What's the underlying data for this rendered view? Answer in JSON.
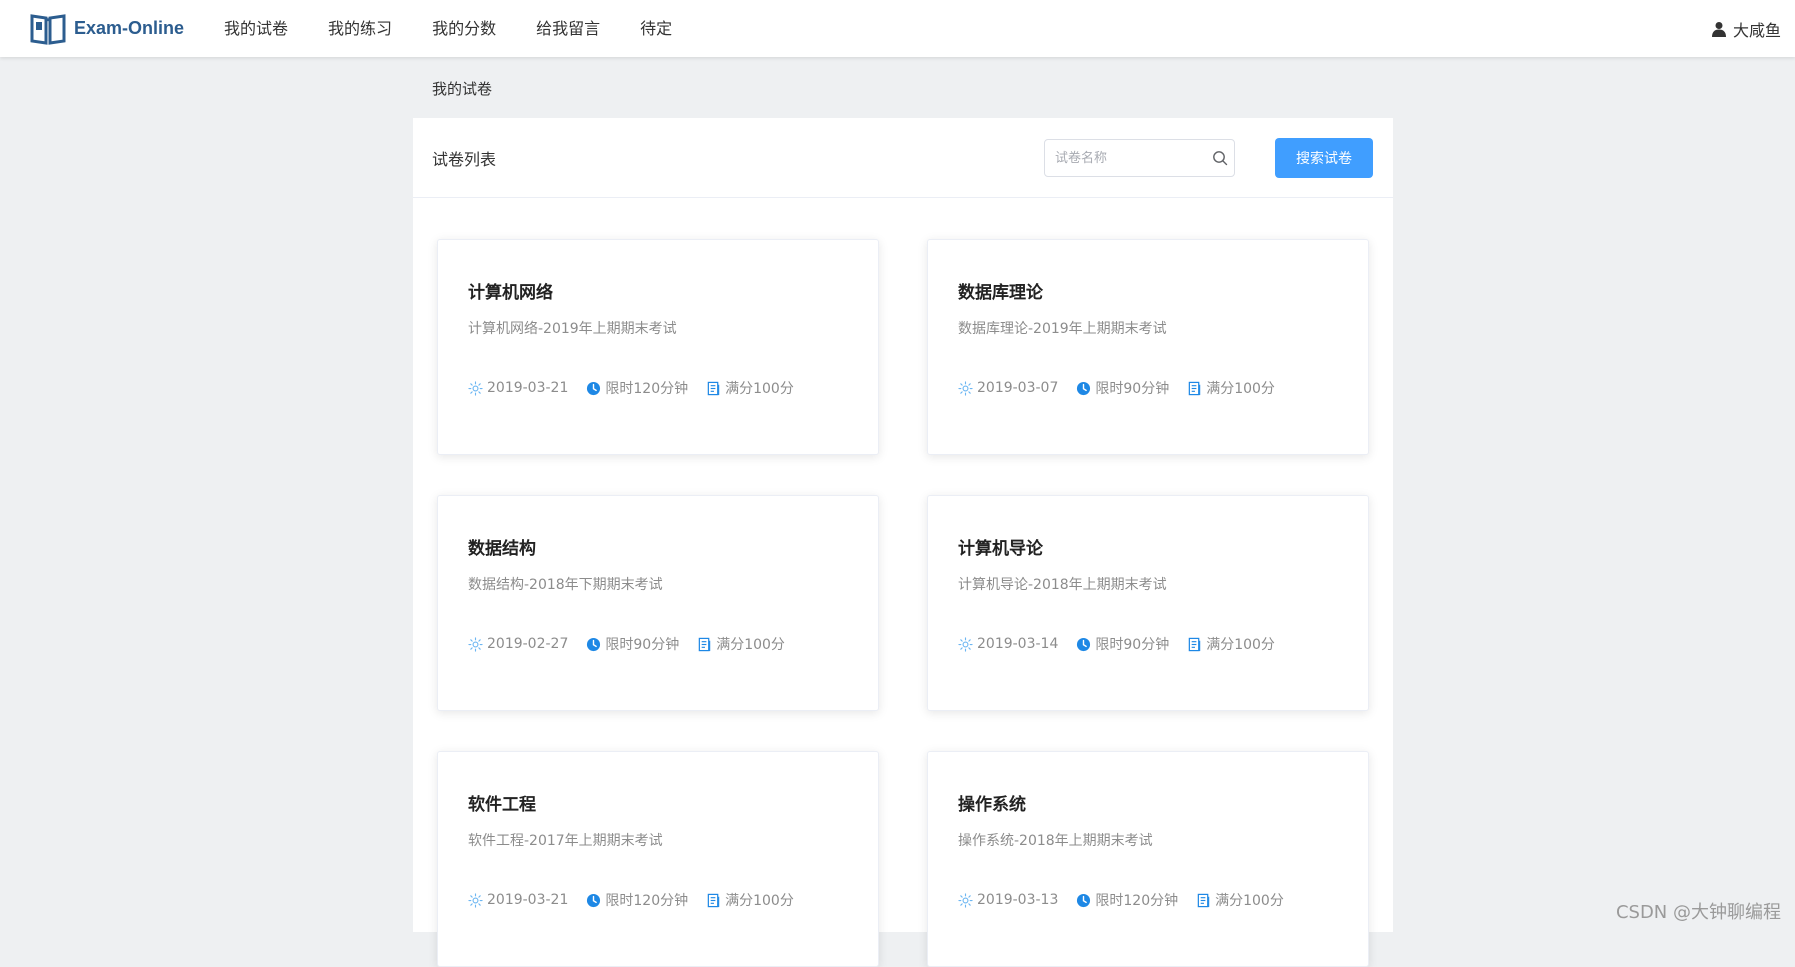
{
  "app": {
    "name": "Exam-Online"
  },
  "nav": {
    "items": [
      {
        "label": "我的试卷"
      },
      {
        "label": "我的练习"
      },
      {
        "label": "我的分数"
      },
      {
        "label": "给我留言"
      },
      {
        "label": "待定"
      }
    ]
  },
  "user": {
    "name": "大咸鱼",
    "icon": "user-icon"
  },
  "breadcrumb": "我的试卷",
  "panel": {
    "title": "试卷列表",
    "search": {
      "placeholder": "试卷名称",
      "value": "",
      "icon": "search-icon"
    },
    "search_button": "搜索试卷"
  },
  "papers": [
    {
      "title": "计算机网络",
      "desc": "计算机网络-2019年上期期末考试",
      "date": "2019-03-21",
      "time": "限时120分钟",
      "score": "满分100分"
    },
    {
      "title": "数据库理论",
      "desc": "数据库理论-2019年上期期末考试",
      "date": "2019-03-07",
      "time": "限时90分钟",
      "score": "满分100分"
    },
    {
      "title": "数据结构",
      "desc": "数据结构-2018年下期期末考试",
      "date": "2019-02-27",
      "time": "限时90分钟",
      "score": "满分100分"
    },
    {
      "title": "计算机导论",
      "desc": "计算机导论-2018年上期期末考试",
      "date": "2019-03-14",
      "time": "限时90分钟",
      "score": "满分100分"
    },
    {
      "title": "软件工程",
      "desc": "软件工程-2017年上期期末考试",
      "date": "2019-03-21",
      "time": "限时120分钟",
      "score": "满分100分"
    },
    {
      "title": "操作系统",
      "desc": "操作系统-2018年上期期末考试",
      "date": "2019-03-13",
      "time": "限时120分钟",
      "score": "满分100分"
    }
  ],
  "icons": {
    "date": "sun-icon",
    "time": "clock-icon",
    "score": "document-icon"
  },
  "colors": {
    "primary": "#409eff",
    "brand": "#2c5d8f",
    "background": "#eef0f2"
  },
  "watermark": "CSDN @大钟聊编程"
}
